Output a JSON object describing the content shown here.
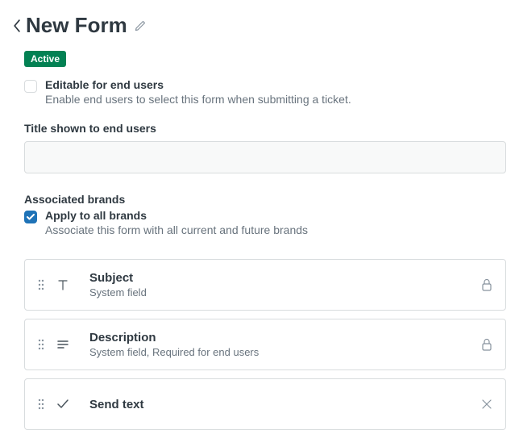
{
  "header": {
    "title": "New Form"
  },
  "status": {
    "label": "Active"
  },
  "editable": {
    "checked": false,
    "label": "Editable for end users",
    "description": "Enable end users to select this form when submitting a ticket."
  },
  "title_section": {
    "label": "Title shown to end users",
    "value": ""
  },
  "brands": {
    "section_label": "Associated brands",
    "apply_all": {
      "checked": true,
      "label": "Apply to all brands",
      "description": "Associate this form with all current and future brands"
    }
  },
  "fields": [
    {
      "icon": "text",
      "title": "Subject",
      "subtitle": "System field",
      "locked": true,
      "removable": false
    },
    {
      "icon": "multiline",
      "title": "Description",
      "subtitle": "System field, Required for end users",
      "locked": true,
      "removable": false
    },
    {
      "icon": "check",
      "title": "Send text",
      "subtitle": "",
      "locked": false,
      "removable": true
    }
  ]
}
